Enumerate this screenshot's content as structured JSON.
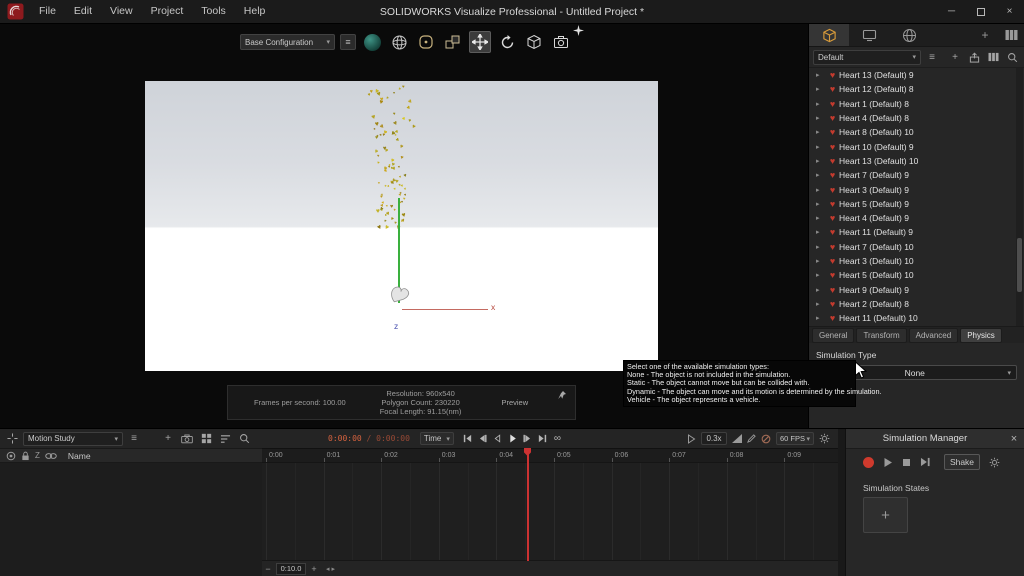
{
  "colors": {
    "accent_orange": "#d89b3a",
    "heart_icon_red": "#c33b2e",
    "record_red": "#cf3a2d",
    "timecode_red": "#d8633f",
    "playhead_red": "#cc3232",
    "teal_sphere": "#2a7a6d",
    "falling_hearts_gold": "#b69a1e",
    "axis_x_red": "#b5453a",
    "axis_z_blue": "#4a52b0",
    "scene_line_green": "#3ab03e"
  },
  "glyphs": {
    "hamburger": "≡",
    "plus": "+",
    "minus": "−",
    "caret_down": "▾",
    "tree_arrow": "▸",
    "heart": "♥",
    "loop": "∞",
    "close": "×",
    "minimize": "─",
    "left_arrow": "◂",
    "right_arrow": "▸"
  },
  "titlebar": {
    "title": "SOLIDWORKS Visualize Professional - Untitled Project *",
    "menus": [
      "File",
      "Edit",
      "View",
      "Project",
      "Tools",
      "Help"
    ]
  },
  "toolbar": {
    "configuration": "Base Configuration"
  },
  "viewport": {
    "axis_labels": {
      "x": "x",
      "z": "z"
    },
    "info_panel": {
      "frames_per_second": "Frames per second: 100.00",
      "resolution": "Resolution: 960x540",
      "polygon_count": "Polygon Count: 230220",
      "focal_length": "Focal Length: 91.15(nm)",
      "preview": "Preview"
    }
  },
  "right_panel": {
    "collection": "Default",
    "tree_items": [
      "Heart 13 (Default) 9",
      "Heart 12 (Default) 8",
      "Heart 1 (Default) 8",
      "Heart 4 (Default) 8",
      "Heart 8 (Default) 10",
      "Heart 10 (Default) 9",
      "Heart 13 (Default) 10",
      "Heart 7 (Default) 9",
      "Heart 3 (Default) 9",
      "Heart 5 (Default) 9",
      "Heart 4 (Default) 9",
      "Heart 11 (Default) 9",
      "Heart 7 (Default) 10",
      "Heart 3 (Default) 10",
      "Heart 5 (Default) 10",
      "Heart 9 (Default) 9",
      "Heart 2 (Default) 8",
      "Heart 11 (Default) 10"
    ],
    "property_tabs": [
      "General",
      "Transform",
      "Advanced",
      "Physics"
    ],
    "active_property_tab": "Physics",
    "physics": {
      "simulation_type_label": "Simulation Type",
      "simulation_type_value": "None"
    }
  },
  "tooltip": {
    "lines": [
      "Select one of the available simulation types:",
      "None - The object is not included in the simulation.",
      "Static - The object cannot move but can be collided with.",
      "Dynamic - The object can move and its motion is determined by the simulation.",
      "Vehicle - The object represents a vehicle."
    ]
  },
  "timeline": {
    "motion_study": "Motion Study",
    "name_header": "Name",
    "timecode_current": "0:00:00",
    "timecode_separator": " / ",
    "timecode_total": "0:00:00",
    "mode": "Time",
    "transport": [
      "skip-start",
      "step-back",
      "play-back",
      "play",
      "step-forward",
      "skip-end",
      "loop"
    ],
    "speed": "0.3x",
    "fps": "60 FPS",
    "ruler_ticks": [
      "0:00",
      "0:01",
      "0:02",
      "0:03",
      "0:04",
      "0:05",
      "0:06",
      "0:07",
      "0:08",
      "0:09"
    ],
    "duration": "0:10.0"
  },
  "simulation_manager": {
    "title": "Simulation Manager",
    "shake": "Shake",
    "states_label": "Simulation States"
  }
}
